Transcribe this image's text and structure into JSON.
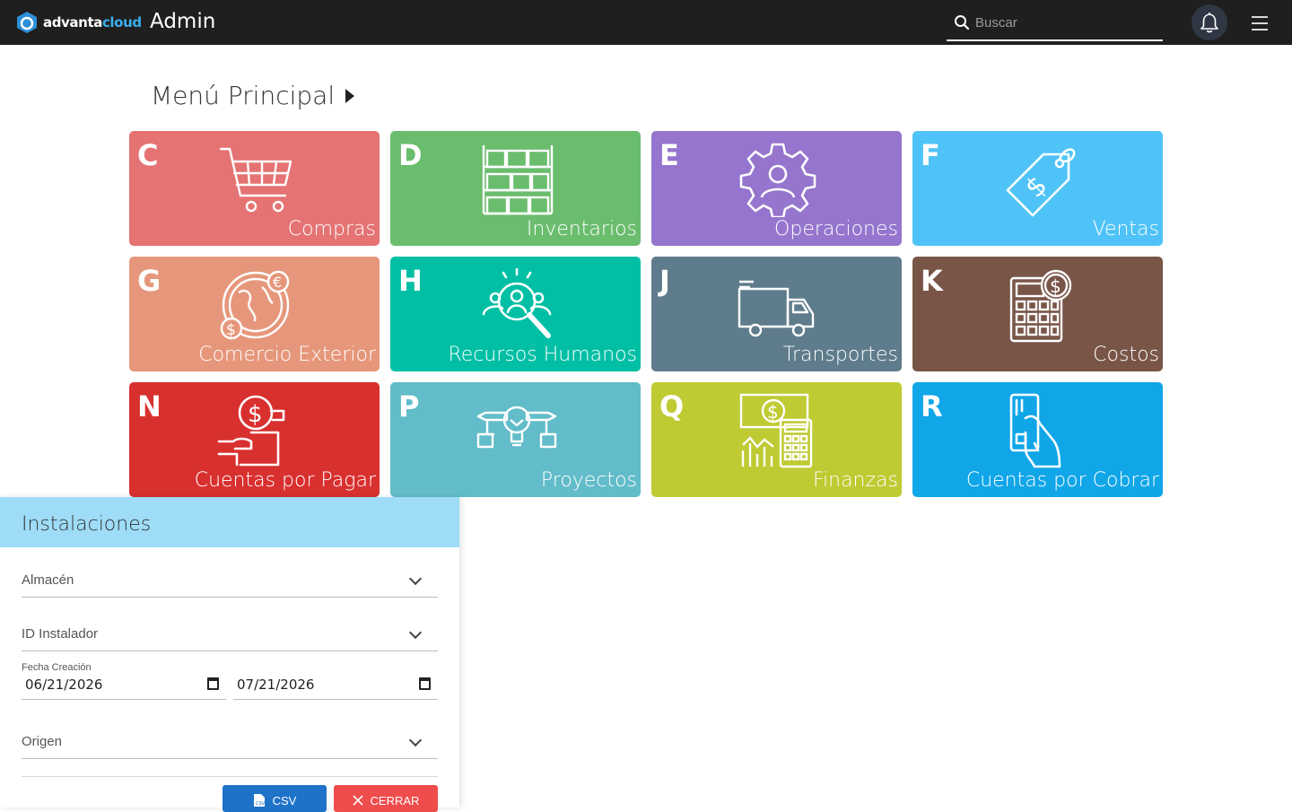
{
  "header": {
    "logo_text_a": "advanta",
    "logo_text_b": "cloud",
    "app_title": "Admin",
    "search_placeholder": "Buscar"
  },
  "main": {
    "title": "Menú Principal",
    "tiles": [
      {
        "letter": "C",
        "label": "Compras",
        "color": "#e57373",
        "icon": "shopping-cart-icon"
      },
      {
        "letter": "D",
        "label": "Inventarios",
        "color": "#6bbd6e",
        "icon": "warehouse-boxes-icon"
      },
      {
        "letter": "E",
        "label": "Operaciones",
        "color": "#9575cd",
        "icon": "gear-person-icon"
      },
      {
        "letter": "F",
        "label": "Ventas",
        "color": "#4fc3f7",
        "icon": "price-tag-icon"
      },
      {
        "letter": "G",
        "label": "Comercio Exterior",
        "color": "#e6977b",
        "icon": "globe-currency-icon"
      },
      {
        "letter": "H",
        "label": "Recursos Humanos",
        "color": "#00bfa5",
        "icon": "people-search-icon"
      },
      {
        "letter": "J",
        "label": "Transportes",
        "color": "#5f7c8c",
        "icon": "truck-icon"
      },
      {
        "letter": "K",
        "label": "Costos",
        "color": "#795548",
        "icon": "calculator-dollar-icon"
      },
      {
        "letter": "N",
        "label": "Cuentas por Pagar",
        "color": "#d8302f",
        "icon": "hand-payment-icon"
      },
      {
        "letter": "P",
        "label": "Proyectos",
        "color": "#62bcc9",
        "icon": "lightbulb-project-icon"
      },
      {
        "letter": "Q",
        "label": "Finanzas",
        "color": "#c0ca33",
        "icon": "finance-calculator-icon"
      },
      {
        "letter": "R",
        "label": "Cuentas por Cobrar",
        "color": "#10a6e8",
        "icon": "hand-card-icon"
      }
    ]
  },
  "panel": {
    "title": "Instalaciones",
    "almacen_label": "Almacén",
    "instalador_label": "ID Instalador",
    "fecha_label": "Fecha Creación",
    "fecha_desde": "06/21/2026",
    "fecha_hasta": "07/21/2026",
    "origen_label": "Origen",
    "csv_label": "CSV",
    "close_label": "CERRAR"
  }
}
